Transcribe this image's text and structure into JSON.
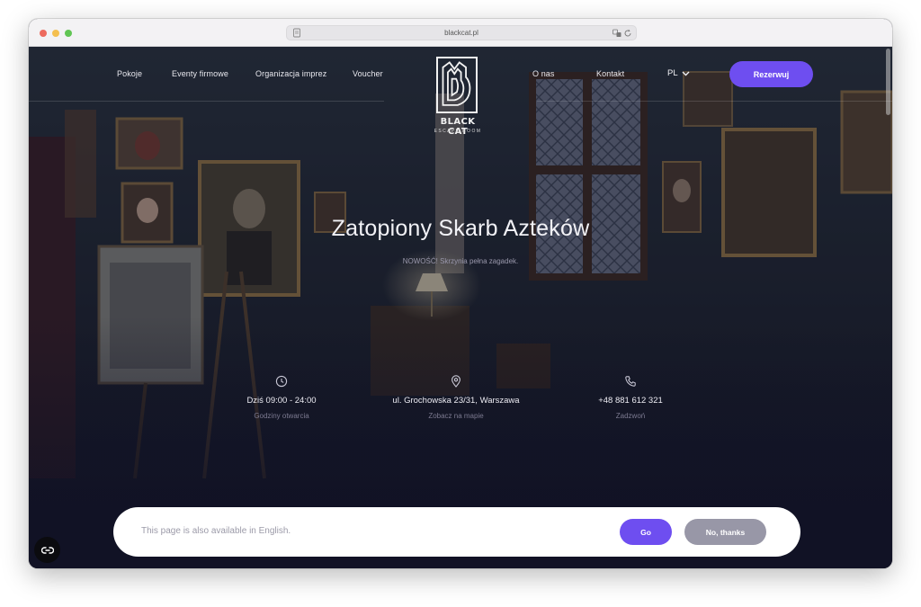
{
  "browser": {
    "url": "blackcat.pl"
  },
  "nav": {
    "left_items": [
      {
        "label": "Pokoje"
      },
      {
        "label": "Eventy firmowe"
      },
      {
        "label": "Organizacja imprez"
      },
      {
        "label": "Voucher"
      }
    ],
    "right_items": [
      {
        "label": "O nas"
      },
      {
        "label": "Kontakt"
      }
    ],
    "language": "PL",
    "book_label": "Rezerwuj"
  },
  "logo": {
    "title": "BLACK CAT",
    "subtitle": "ESCAPE ROOM"
  },
  "hero": {
    "title": "Zatopiony Skarb Azteków",
    "subtitle": "NOWOŚĆ! Skrzynia pełna zagadek."
  },
  "info": [
    {
      "icon": "clock-icon",
      "main": "Dziś 09:00 - 24:00",
      "sub": "Godziny otwarcia"
    },
    {
      "icon": "location-pin-icon",
      "main": "ul. Grochowska 23/31, Warszawa",
      "sub": "Zobacz na mapie"
    },
    {
      "icon": "phone-icon",
      "main": "+48 881 612 321",
      "sub": "Zadzwoń"
    }
  ],
  "language_banner": {
    "message": "This page is also available in English.",
    "go_label": "Go",
    "no_label": "No, thanks"
  },
  "colors": {
    "accent": "#6e4ef0",
    "secondary_button": "#9897a7",
    "hero_dark": "#111225"
  }
}
